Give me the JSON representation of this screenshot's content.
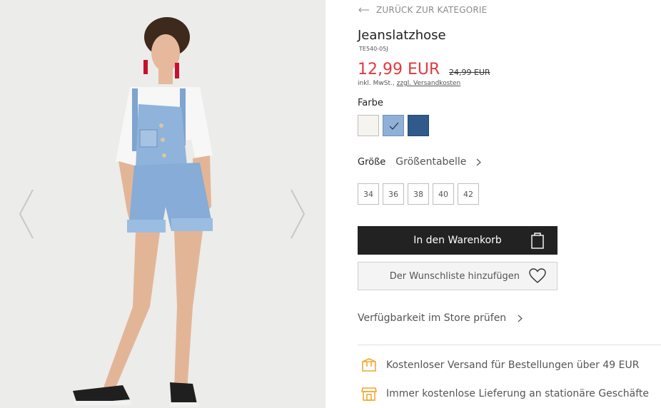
{
  "gallery": {
    "image_alt": "",
    "prev_icon": "chevron-left-icon",
    "next_icon": "chevron-right-icon"
  },
  "nav": {
    "back_label": "ZURÜCK ZUR KATEGORIE",
    "back_icon": "arrow-left-icon"
  },
  "product": {
    "title": "Jeanslatzhose",
    "sku": "TE540-05J",
    "price": "12,99 EUR",
    "old_price": "24,99 EUR",
    "tax_prefix": "inkl. MwSt.,",
    "shipping_link": "zzgl. Versandkosten"
  },
  "colors": {
    "label": "Farbe",
    "swatches": [
      {
        "name": "cream",
        "hex": "#f6f4ef",
        "selected": false
      },
      {
        "name": "light-denim",
        "hex": "#8fb1d8",
        "selected": true
      },
      {
        "name": "dark-denim",
        "hex": "#2f5a8b",
        "selected": false
      }
    ]
  },
  "sizes": {
    "label": "Größe",
    "chart_label": "Größentabelle",
    "options": [
      "34",
      "36",
      "38",
      "40",
      "42"
    ]
  },
  "actions": {
    "cart_label": "In den Warenkorb",
    "cart_icon": "shopping-bag-icon",
    "wishlist_label": "Der Wunschliste hinzufügen",
    "wishlist_icon": "heart-icon",
    "store_check_label": "Verfügbarkeit im Store prüfen"
  },
  "perks": [
    {
      "icon": "delivery-box-icon",
      "text": "Kostenloser Versand für Bestellungen über 49 EUR"
    },
    {
      "icon": "store-icon",
      "text": "Immer kostenlose Lieferung an stationäre Geschäfte"
    }
  ],
  "colors_theme": {
    "sale_red": "#e0393e",
    "button_dark": "#222222",
    "accent_orange": "#f0a830"
  }
}
